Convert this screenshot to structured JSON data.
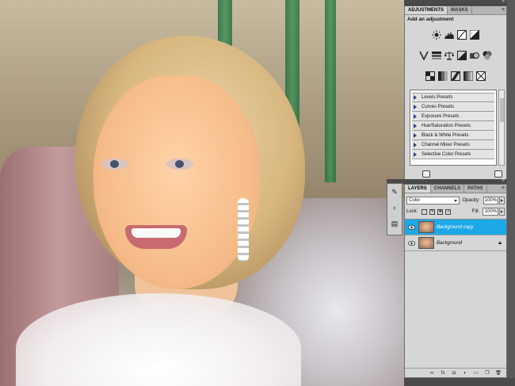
{
  "adjustments_panel": {
    "tabs": [
      "ADJUSTMENTS",
      "MASKS"
    ],
    "title": "Add an adjustment",
    "icons_row1": [
      "brightness-contrast-icon",
      "levels-icon",
      "curves-icon",
      "exposure-icon"
    ],
    "icons_row2": [
      "vibrance-icon",
      "hue-saturation-icon",
      "color-balance-icon",
      "black-white-icon",
      "photo-filter-icon",
      "channel-mixer-icon"
    ],
    "icons_row3": [
      "invert-icon",
      "posterize-icon",
      "threshold-icon",
      "gradient-map-icon",
      "selective-color-icon"
    ],
    "presets": [
      "Levels Presets",
      "Curves Presets",
      "Exposure Presets",
      "Hue/Saturation Presets",
      "Black & White Presets",
      "Channel Mixer Presets",
      "Selective Color Presets"
    ]
  },
  "layers_panel": {
    "tabs": [
      "LAYERS",
      "CHANNELS",
      "PATHS"
    ],
    "blend_mode": "Color",
    "opacity_label": "Opacity:",
    "opacity_value": "100%",
    "lock_label": "Lock:",
    "fill_label": "Fill:",
    "fill_value": "100%",
    "layers": [
      {
        "name": "Background copy",
        "selected": true
      },
      {
        "name": "Background",
        "selected": false
      }
    ]
  },
  "colors": {
    "selection": "#1da9e8",
    "panel_bg": "#d6d6d6"
  }
}
